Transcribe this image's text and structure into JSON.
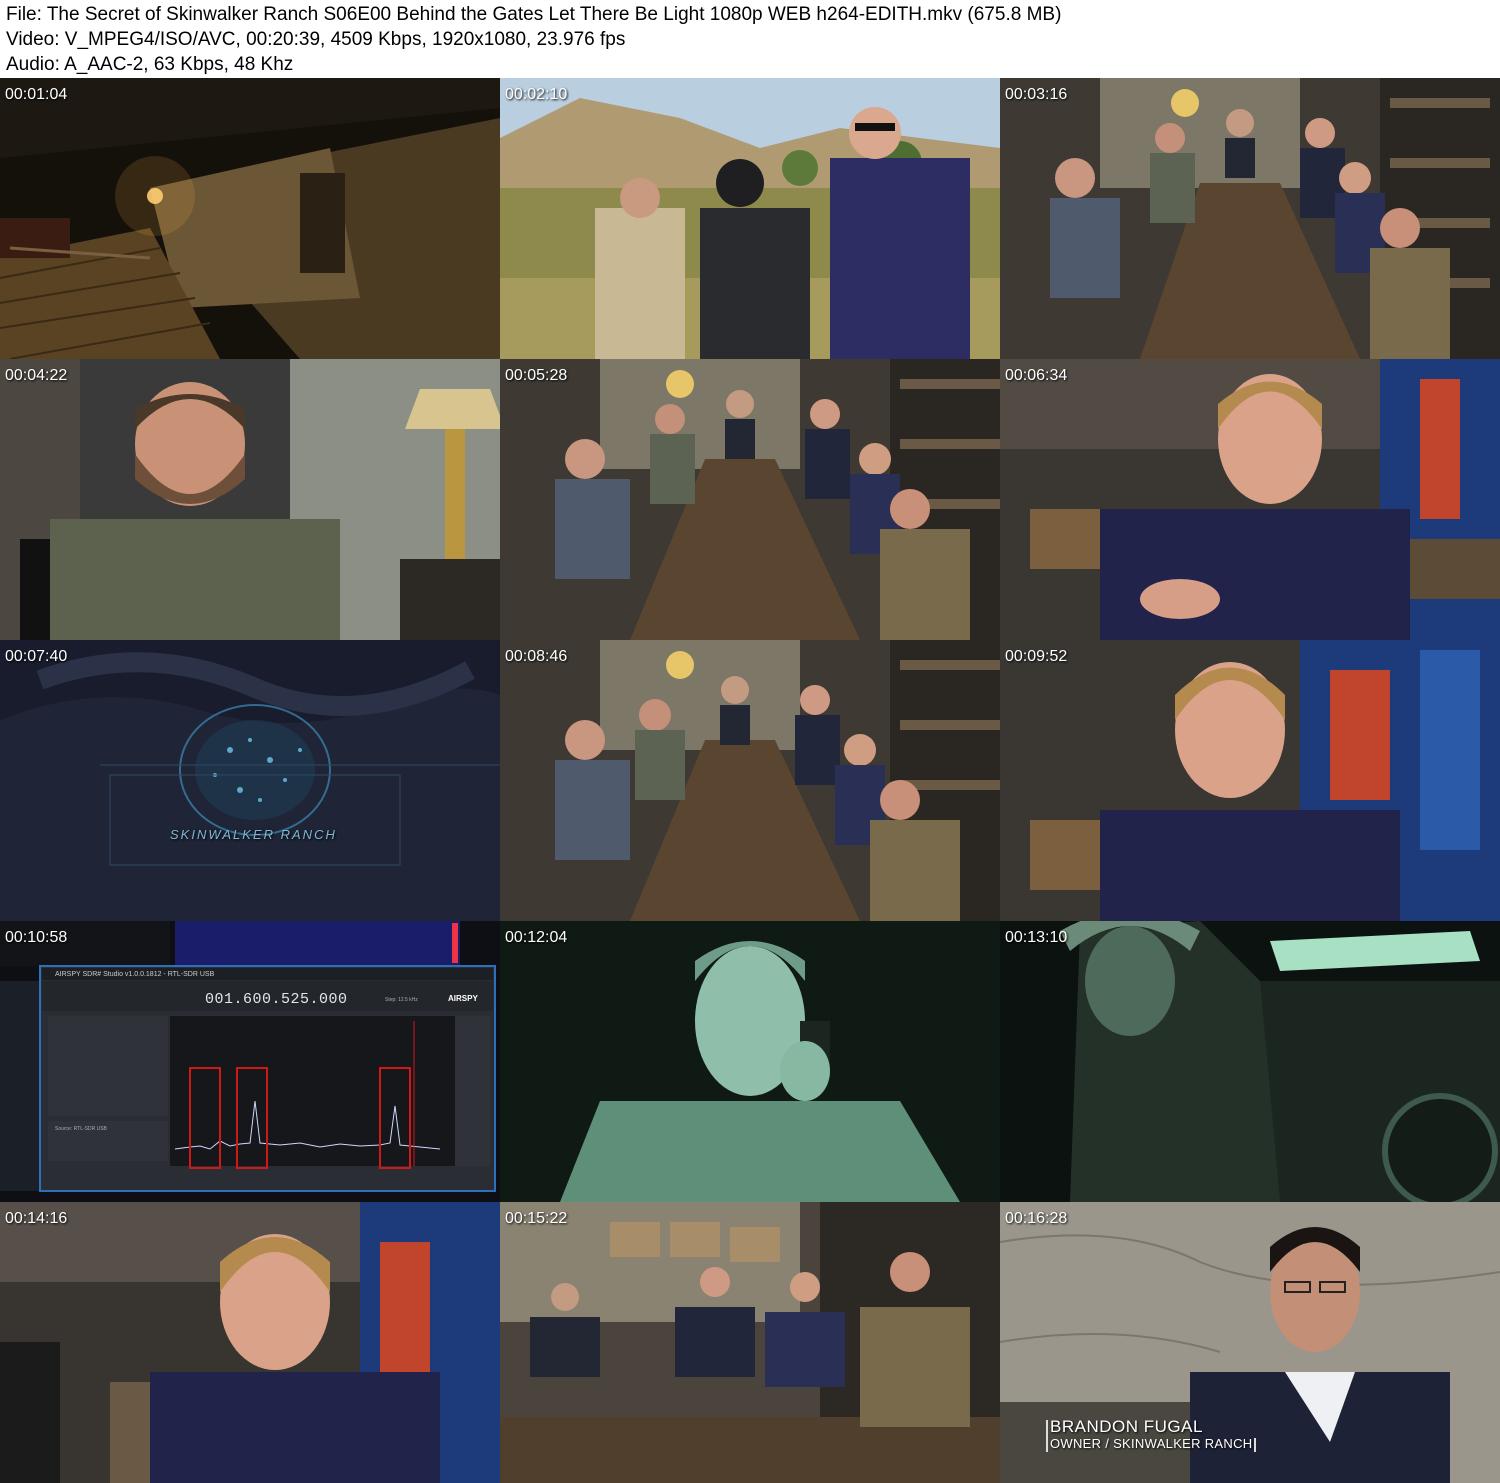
{
  "header": {
    "file_line": "File: The Secret of Skinwalker Ranch S06E00 Behind the Gates Let There Be Light 1080p WEB h264-EDITH.mkv (675.8 MB)",
    "video_line": "Video: V_MPEG4/ISO/AVC, 00:20:39, 4509 Kbps, 1920x1080, 23.976 fps",
    "audio_line": "Audio: A_AAC-2, 63 Kbps, 48 Khz"
  },
  "thumbnails": [
    {
      "timestamp": "00:01:04",
      "scene": "porch-night"
    },
    {
      "timestamp": "00:02:10",
      "scene": "field-three-men"
    },
    {
      "timestamp": "00:03:16",
      "scene": "conference-table"
    },
    {
      "timestamp": "00:04:22",
      "scene": "bearded-man-interview"
    },
    {
      "timestamp": "00:05:28",
      "scene": "conference-table"
    },
    {
      "timestamp": "00:06:34",
      "scene": "blond-man-interview"
    },
    {
      "timestamp": "00:07:40",
      "scene": "title-card"
    },
    {
      "timestamp": "00:08:46",
      "scene": "conference-table"
    },
    {
      "timestamp": "00:09:52",
      "scene": "blond-man-interview"
    },
    {
      "timestamp": "00:10:58",
      "scene": "sdr-software"
    },
    {
      "timestamp": "00:12:04",
      "scene": "night-vision-radio"
    },
    {
      "timestamp": "00:13:10",
      "scene": "night-vision-vehicle"
    },
    {
      "timestamp": "00:14:16",
      "scene": "blond-man-talking"
    },
    {
      "timestamp": "00:15:22",
      "scene": "conference-group"
    },
    {
      "timestamp": "00:16:28",
      "scene": "brandon-interview"
    }
  ],
  "title_card_text": "SKINWALKER RANCH",
  "sdr": {
    "window_title": "AIRSPY SDR# Studio v1.0.0.1812 - RTL-SDR USB",
    "frequency": "001.600.525.000",
    "logo": "AIRSPY",
    "step": "Step: 12.5 kHz",
    "source": "Source: RTL-SDR USB"
  },
  "lower_third": {
    "name": "BRANDON FUGAL",
    "title": "OWNER / SKINWALKER RANCH"
  }
}
